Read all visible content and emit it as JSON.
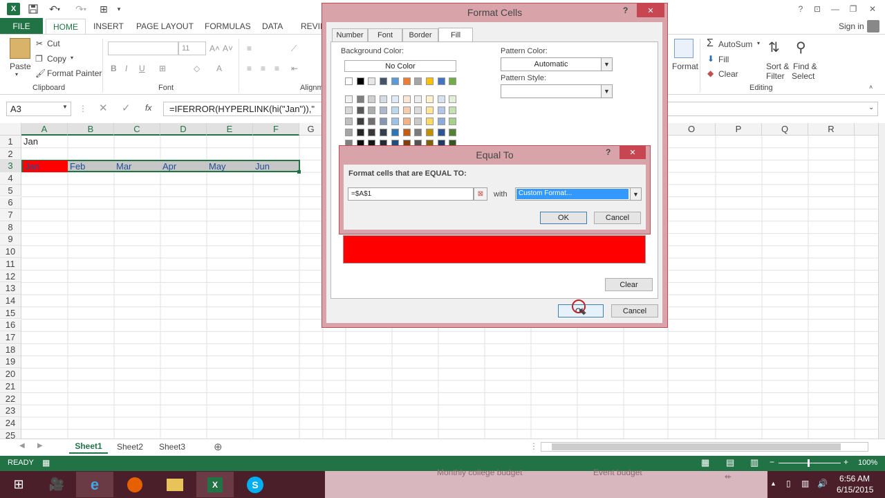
{
  "app": {
    "title": "Format Cells",
    "qat_logo": "X",
    "signin": "Sign in"
  },
  "tabs": {
    "file": "FILE",
    "items": [
      "HOME",
      "INSERT",
      "PAGE LAYOUT",
      "FORMULAS",
      "DATA",
      "REVIEW"
    ]
  },
  "ribbon": {
    "clipboard": {
      "paste": "Paste",
      "cut": "Cut",
      "copy": "Copy",
      "format_painter": "Format Painter",
      "label": "Clipboard"
    },
    "font": {
      "size": "11",
      "label": "Font"
    },
    "alignment": {
      "label": "Alignm"
    },
    "format": {
      "label": "Format"
    },
    "editing": {
      "autosum": "AutoSum",
      "fill": "Fill",
      "clear": "Clear",
      "sort_filter_1": "Sort &",
      "sort_filter_2": "Filter",
      "find_select_1": "Find &",
      "find_select_2": "Select",
      "label": "Editing"
    }
  },
  "formula_bar": {
    "name_box": "A3",
    "fx": "fx",
    "formula": "=IFERROR(HYPERLINK(hi(\"Jan\")),\""
  },
  "grid": {
    "columns": [
      "A",
      "B",
      "C",
      "D",
      "E",
      "F",
      "G",
      "O",
      "P",
      "Q",
      "R"
    ],
    "rows": [
      "1",
      "2",
      "3",
      "4",
      "5",
      "6",
      "7",
      "8",
      "9",
      "10",
      "11",
      "12",
      "13",
      "14",
      "15",
      "16",
      "17",
      "18",
      "19",
      "20",
      "21",
      "22",
      "23",
      "24",
      "25"
    ],
    "a1": "Jan",
    "row3": [
      "Jan",
      "Feb",
      "Mar",
      "Apr",
      "May",
      "Jun"
    ]
  },
  "sheets": [
    "Sheet1",
    "Sheet2",
    "Sheet3"
  ],
  "status": {
    "ready": "READY",
    "zoom": "100%"
  },
  "taskbar": {
    "time": "6:56 AM",
    "date": "6/15/2015",
    "bg_item_1": "Monthly college budget",
    "bg_item_2": "Event budget"
  },
  "format_cells": {
    "title": "Format Cells",
    "help": "?",
    "close": "✕",
    "tabs": [
      "Number",
      "Font",
      "Border",
      "Fill"
    ],
    "background_color_label": "Background Color:",
    "no_color": "No Color",
    "pattern_color_label": "Pattern Color:",
    "pattern_color_value": "Automatic",
    "pattern_style_label": "Pattern Style:",
    "clear": "Clear",
    "ok": "OK",
    "cancel": "Cancel",
    "sample_color": "#ff0000",
    "theme_top_row": [
      "#ffffff",
      "#000000",
      "#e7e6e6",
      "#44546a",
      "#5b9bd5",
      "#ed7d31",
      "#a5a5a5",
      "#ffc000",
      "#4472c4",
      "#70ad47"
    ],
    "theme_shades": [
      [
        "#f2f2f2",
        "#7f7f7f",
        "#d0cece",
        "#d6dce4",
        "#deebf6",
        "#fbe5d5",
        "#ededed",
        "#fff2cc",
        "#d9e2f3",
        "#e2efd9"
      ],
      [
        "#d8d8d8",
        "#595959",
        "#aeabab",
        "#adb9ca",
        "#bdd7ee",
        "#f7cbac",
        "#dbdbdb",
        "#fee599",
        "#b4c6e7",
        "#c5e0b3"
      ],
      [
        "#bfbfbf",
        "#3f3f3f",
        "#757070",
        "#8496b0",
        "#9cc3e5",
        "#f4b183",
        "#c9c9c9",
        "#ffd965",
        "#8eaadb",
        "#a8d08d"
      ],
      [
        "#a5a5a5",
        "#262626",
        "#3a3838",
        "#323f4f",
        "#2e75b5",
        "#c55a11",
        "#7b7b7b",
        "#bf9000",
        "#2f5496",
        "#538135"
      ],
      [
        "#7f7f7f",
        "#0c0c0c",
        "#171616",
        "#222a35",
        "#1e4e79",
        "#833c0b",
        "#525252",
        "#7f6000",
        "#1f3864",
        "#375623"
      ]
    ]
  },
  "equal_to": {
    "title": "Equal To",
    "help": "?",
    "close": "✕",
    "prompt": "Format cells that are EQUAL TO:",
    "value": "=$A$1",
    "with_label": "with",
    "format_value": "Custom Format...",
    "ok": "OK",
    "cancel": "Cancel"
  },
  "colors": {
    "excel_green": "#217346",
    "highlight_red": "#ff0000",
    "dialog_border": "#c24a55"
  }
}
